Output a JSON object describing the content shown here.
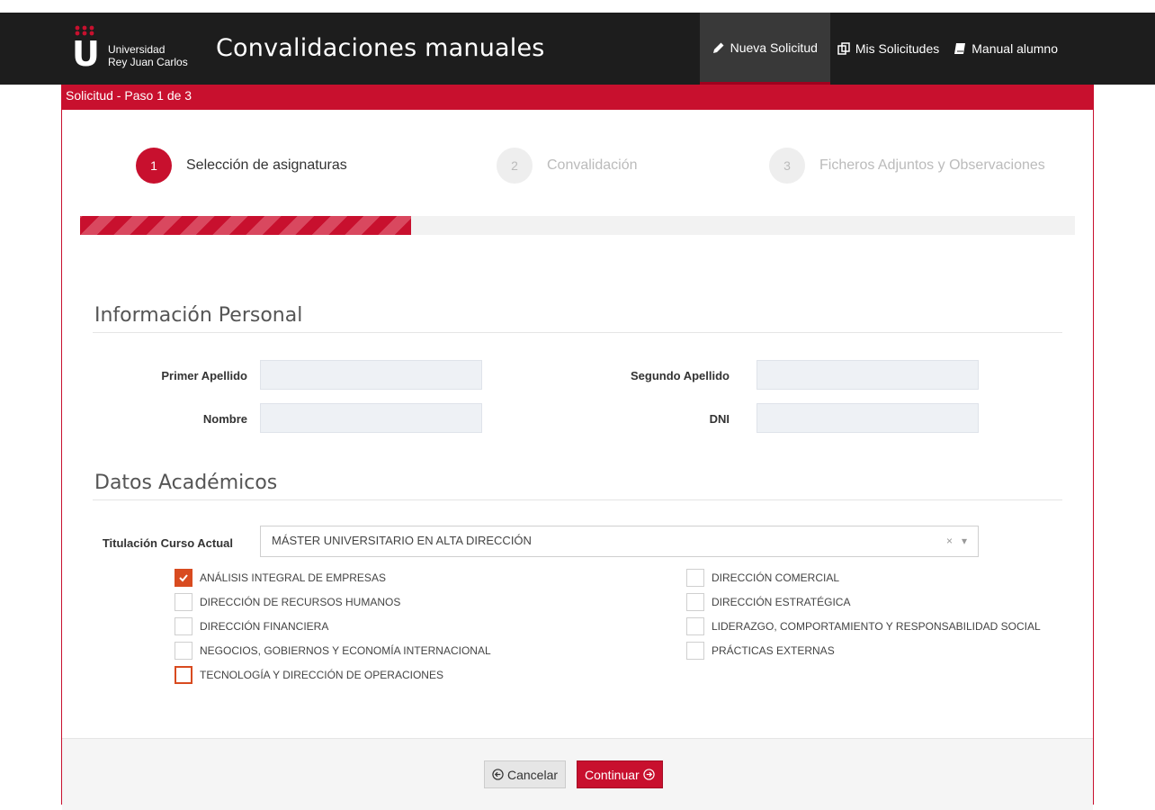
{
  "brand": {
    "logo_letter": "U",
    "logo_line1": "Universidad",
    "logo_line2": "Rey Juan Carlos",
    "app_title": "Convalidaciones manuales",
    "accent": "#c8102e"
  },
  "nav": {
    "items": [
      {
        "label": "Nueva Solicitud",
        "icon": "pencil-icon",
        "active": true
      },
      {
        "label": "Mis Solicitudes",
        "icon": "copy-icon",
        "active": false
      },
      {
        "label": "Manual alumno",
        "icon": "book-icon",
        "active": false
      }
    ]
  },
  "panel": {
    "header": "Solicitud - Paso 1 de 3"
  },
  "wizard": {
    "steps": [
      {
        "number": "1",
        "label": "Selección de asignaturas",
        "state": "active"
      },
      {
        "number": "2",
        "label": "Convalidación",
        "state": "inactive"
      },
      {
        "number": "3",
        "label": "Ficheros Adjuntos y Observaciones",
        "state": "inactive"
      }
    ],
    "progress": 0.333
  },
  "personal": {
    "title": "Información Personal",
    "primer_apellido": {
      "label": "Primer Apellido",
      "value": ""
    },
    "segundo_apellido": {
      "label": "Segundo Apellido",
      "value": ""
    },
    "nombre": {
      "label": "Nombre",
      "value": ""
    },
    "dni": {
      "label": "DNI",
      "value": ""
    }
  },
  "academic": {
    "title": "Datos Académicos",
    "titulacion_label": "Titulación Curso Actual",
    "titulacion_value": "MÁSTER UNIVERSITARIO EN ALTA DIRECCIÓN",
    "clear_glyph": "×",
    "subjects_left": [
      {
        "label": "ANÁLISIS INTEGRAL DE EMPRESAS",
        "checked": true
      },
      {
        "label": "DIRECCIÓN DE RECURSOS HUMANOS",
        "checked": false
      },
      {
        "label": "DIRECCIÓN FINANCIERA",
        "checked": false
      },
      {
        "label": "NEGOCIOS, GOBIERNOS Y ECONOMÍA INTERNACIONAL",
        "checked": false
      },
      {
        "label": "TECNOLOGÍA Y DIRECCIÓN DE OPERACIONES",
        "checked": false
      }
    ],
    "subjects_right": [
      {
        "label": "DIRECCIÓN COMERCIAL",
        "checked": false
      },
      {
        "label": "DIRECCIÓN ESTRATÉGICA",
        "checked": false
      },
      {
        "label": "LIDERAZGO, COMPORTAMIENTO Y RESPONSABILIDAD SOCIAL",
        "checked": false
      },
      {
        "label": "PRÁCTICAS EXTERNAS",
        "checked": false
      }
    ]
  },
  "footer": {
    "cancel_label": "Cancelar",
    "continue_label": "Continuar"
  }
}
